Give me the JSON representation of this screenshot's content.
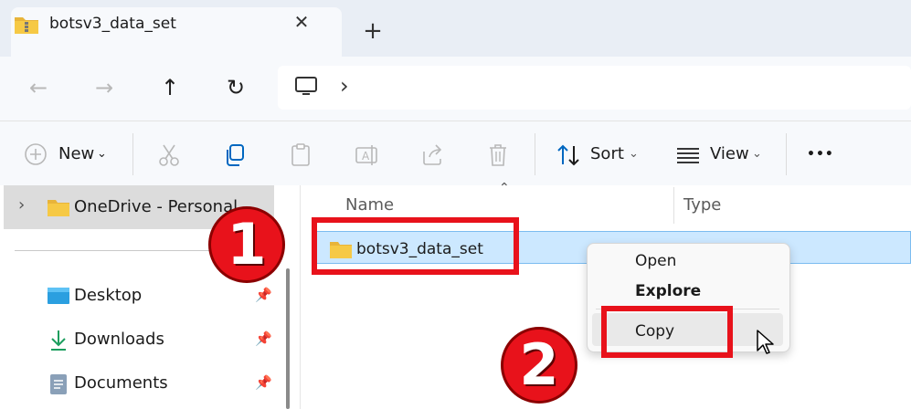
{
  "tab": {
    "title": "botsv3_data_set",
    "close_glyph": "✕",
    "new_glyph": "+"
  },
  "toolbar": {
    "new_label": "New",
    "sort_label": "Sort",
    "view_label": "View",
    "more_glyph": "•••"
  },
  "navigation": {
    "back_glyph": "←",
    "forward_glyph": "→",
    "up_glyph": "↑",
    "refresh_glyph": "↻",
    "breadcrumb_chevron": "›"
  },
  "sidebar": {
    "items": [
      {
        "label": "OneDrive - Personal",
        "icon": "folder-icon"
      },
      {
        "label": "Desktop",
        "icon": "desktop-icon",
        "pinned": true
      },
      {
        "label": "Downloads",
        "icon": "download-icon",
        "pinned": true
      },
      {
        "label": "Documents",
        "icon": "documents-icon",
        "pinned": true
      }
    ]
  },
  "filelist": {
    "columns": [
      "Name",
      "Type"
    ],
    "rows": [
      {
        "name": "botsv3_data_set",
        "icon": "folder-icon",
        "selected": true
      }
    ]
  },
  "context_menu": {
    "items": [
      "Open",
      "Explore",
      "Copy"
    ]
  },
  "annotations": {
    "step1": "1",
    "step2": "2"
  },
  "colors": {
    "accent": "#0067c0",
    "annotation_red": "#e8121b",
    "selection": "#cce8ff",
    "folder_yellow": "#f6c945"
  }
}
